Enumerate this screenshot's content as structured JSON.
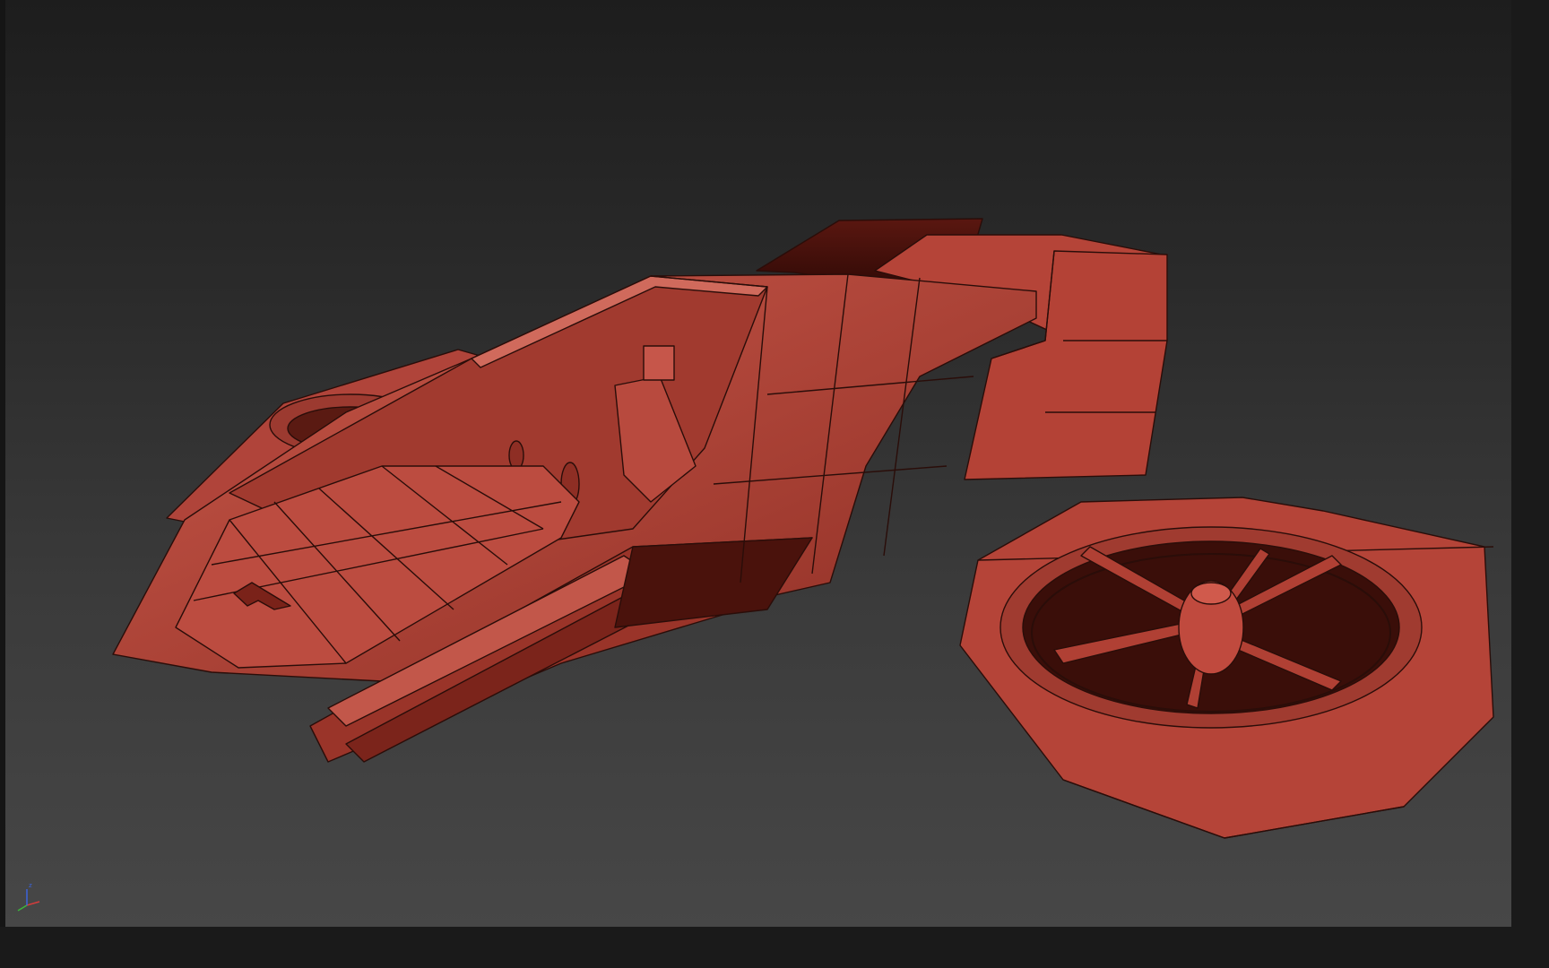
{
  "viewport": {
    "background_top": "#1d1d1d",
    "background_bottom": "#474747",
    "model_color": "#b8473a",
    "wire_color": "#2a0d09"
  },
  "axis_gizmo": {
    "icon": "xyz-axis-icon",
    "axis_colors": {
      "x": "#d23c3c",
      "y": "#3cb43c",
      "z": "#3c64dc"
    },
    "z_label": "z"
  }
}
